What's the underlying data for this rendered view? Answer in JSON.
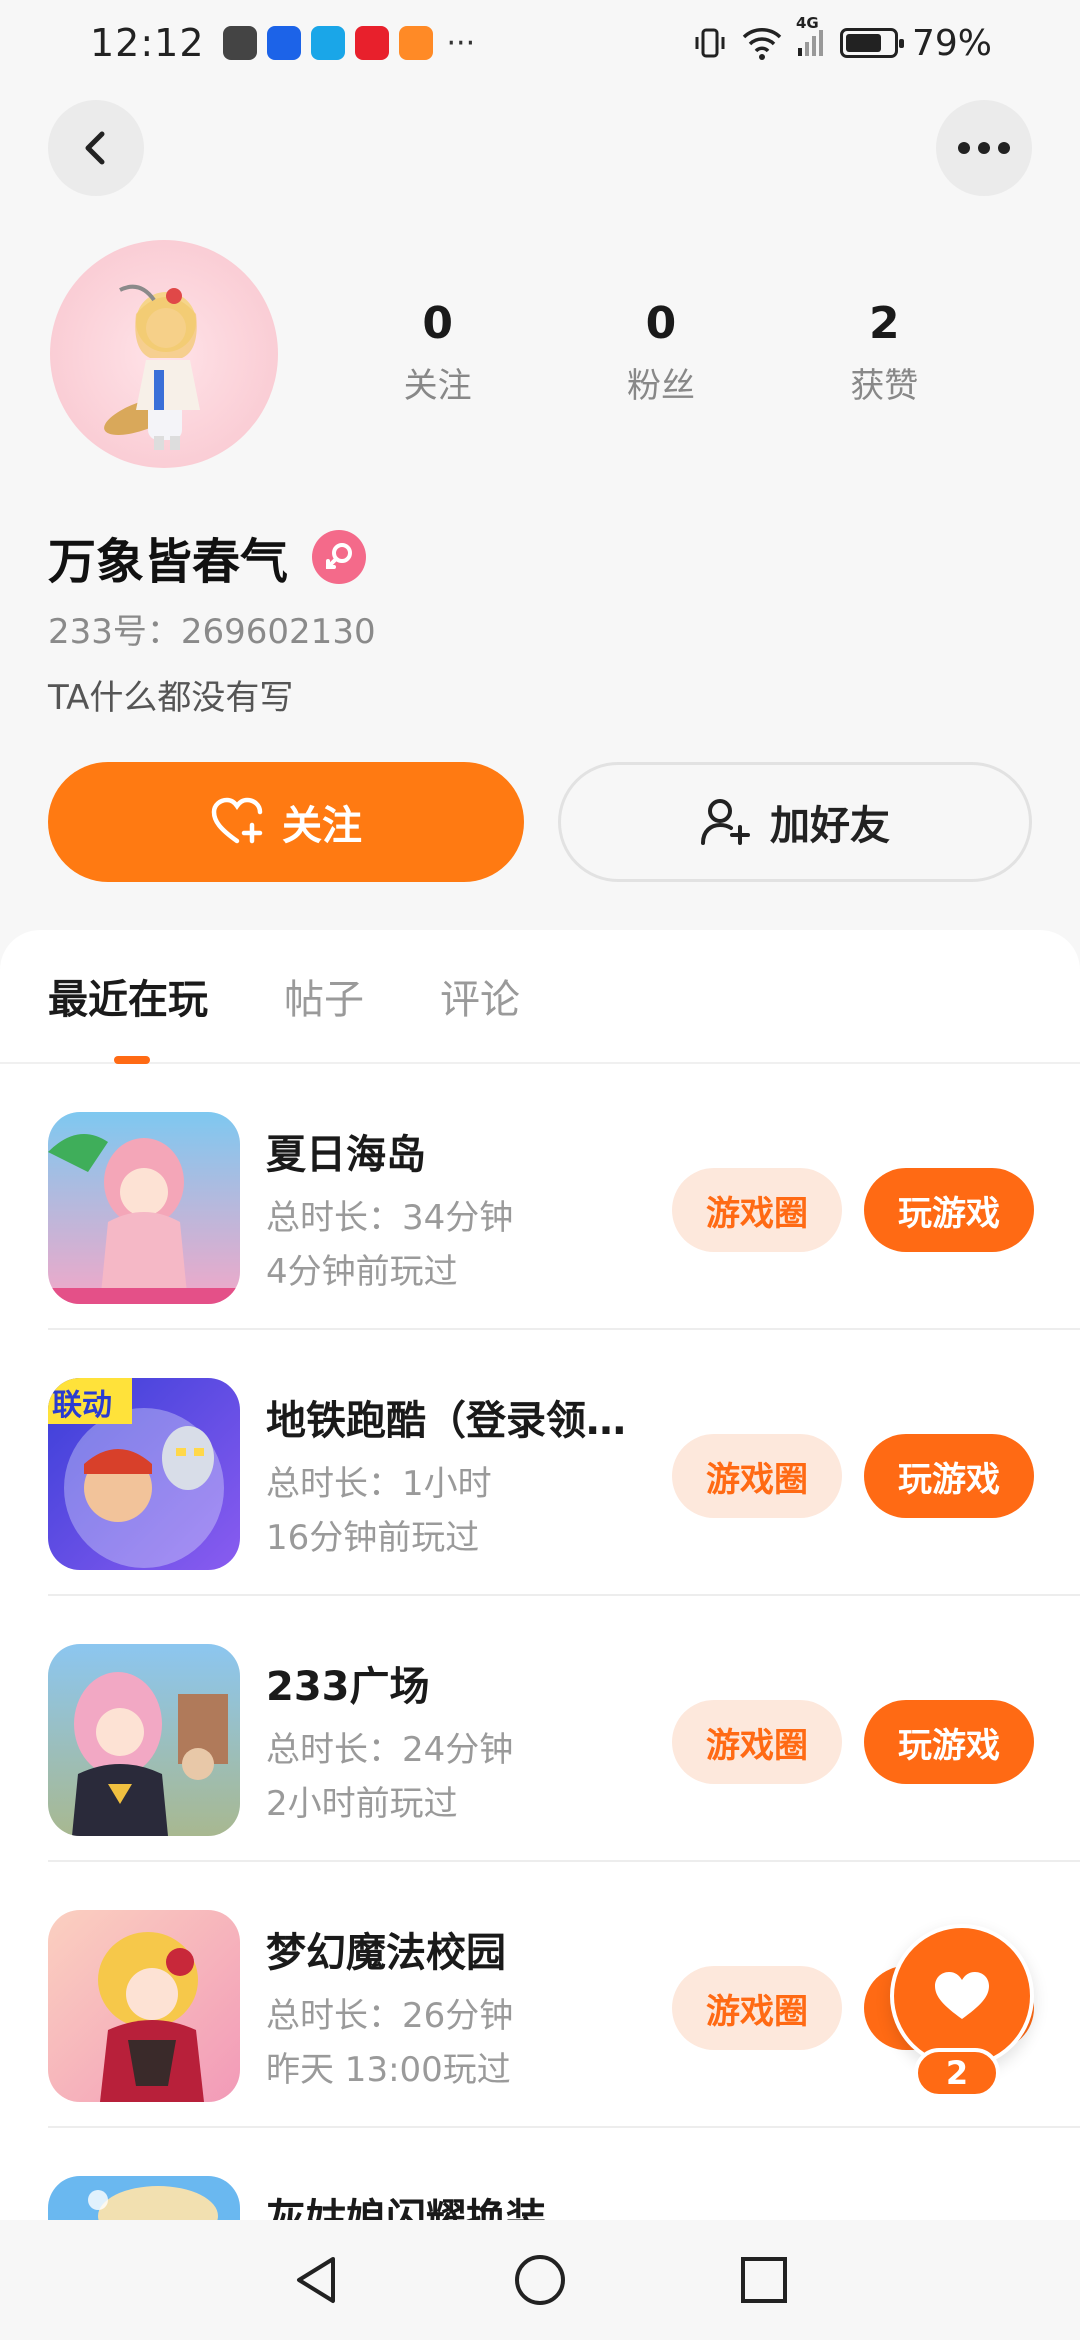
{
  "status_bar": {
    "time": "12:12",
    "dots": "···",
    "network": "4G",
    "battery_text": "79%",
    "battery_level": 0.79
  },
  "profile": {
    "stats": [
      {
        "value": "0",
        "label": "关注"
      },
      {
        "value": "0",
        "label": "粉丝"
      },
      {
        "value": "2",
        "label": "获赞"
      }
    ],
    "username": "万象皆春气",
    "uid": "233号：269602130",
    "bio": "TA什么都没有写"
  },
  "actions": {
    "follow_label": "关注",
    "add_friend_label": "加好友"
  },
  "tabs": [
    {
      "label": "最近在玩",
      "active": true
    },
    {
      "label": "帖子",
      "active": false
    },
    {
      "label": "评论",
      "active": false
    }
  ],
  "games": [
    {
      "title": "夏日海岛",
      "duration": "总时长：34分钟",
      "last_played": "4分钟前玩过",
      "circle_label": "游戏圈",
      "play_label": "玩游戏"
    },
    {
      "title": "地铁跑酷（登录领…",
      "duration": "总时长：1小时",
      "last_played": "16分钟前玩过",
      "circle_label": "游戏圈",
      "play_label": "玩游戏",
      "thumb_badge": "联动"
    },
    {
      "title": "233广场",
      "duration": "总时长：24分钟",
      "last_played": "2小时前玩过",
      "circle_label": "游戏圈",
      "play_label": "玩游戏"
    },
    {
      "title": "梦幻魔法校园",
      "duration": "总时长：26分钟",
      "last_played": "昨天 13:00玩过",
      "circle_label": "游戏圈",
      "play_label": "玩游戏"
    },
    {
      "title": "灰姑娘闪耀换装",
      "duration": "",
      "last_played": "",
      "circle_label": "",
      "play_label": ""
    }
  ],
  "float_like": {
    "count": "2"
  },
  "colors": {
    "accent": "#ff6a14",
    "accent_soft": "#fde8dc",
    "gender": "#f46a8a"
  },
  "icons": [
    "back-icon",
    "more-icon",
    "heart-plus-icon",
    "user-plus-icon",
    "heart-icon",
    "nav-back-icon",
    "nav-home-icon",
    "nav-recent-icon"
  ]
}
